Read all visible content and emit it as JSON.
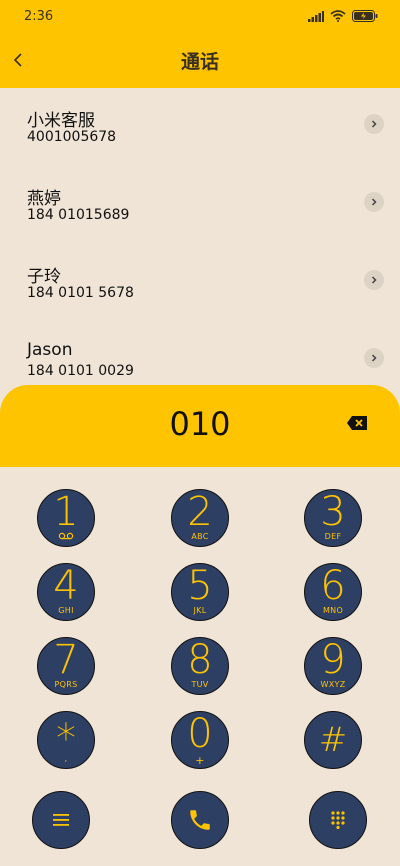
{
  "status_bar": {
    "time": "2:36"
  },
  "header": {
    "title": "通话"
  },
  "contacts": [
    {
      "name": "小米客服",
      "number": "4001005678"
    },
    {
      "name": "燕婷",
      "number": "184 01015689"
    },
    {
      "name": "子玲",
      "number": "184 0101 5678"
    },
    {
      "name": "Jason",
      "number": "184 0101 0029"
    }
  ],
  "dialer": {
    "input": "010"
  },
  "keys": [
    {
      "digit": "1",
      "letters": ""
    },
    {
      "digit": "2",
      "letters": "ABC"
    },
    {
      "digit": "3",
      "letters": "DEF"
    },
    {
      "digit": "4",
      "letters": "GHI"
    },
    {
      "digit": "5",
      "letters": "JKL"
    },
    {
      "digit": "6",
      "letters": "MNO"
    },
    {
      "digit": "7",
      "letters": "PQRS"
    },
    {
      "digit": "8",
      "letters": "TUV"
    },
    {
      "digit": "9",
      "letters": "WXYZ"
    },
    {
      "digit": "*",
      "letters": ","
    },
    {
      "digit": "0",
      "letters": "+"
    },
    {
      "digit": "#",
      "letters": ""
    }
  ],
  "colors": {
    "accent": "#ffc400",
    "key_bg": "#2e3f64",
    "background": "#efe4d6"
  },
  "icons": {
    "voicemail": "voicemail-icon",
    "menu": "menu-icon",
    "call": "phone-icon",
    "keypad": "dialpad-icon",
    "delete": "backspace-icon"
  }
}
